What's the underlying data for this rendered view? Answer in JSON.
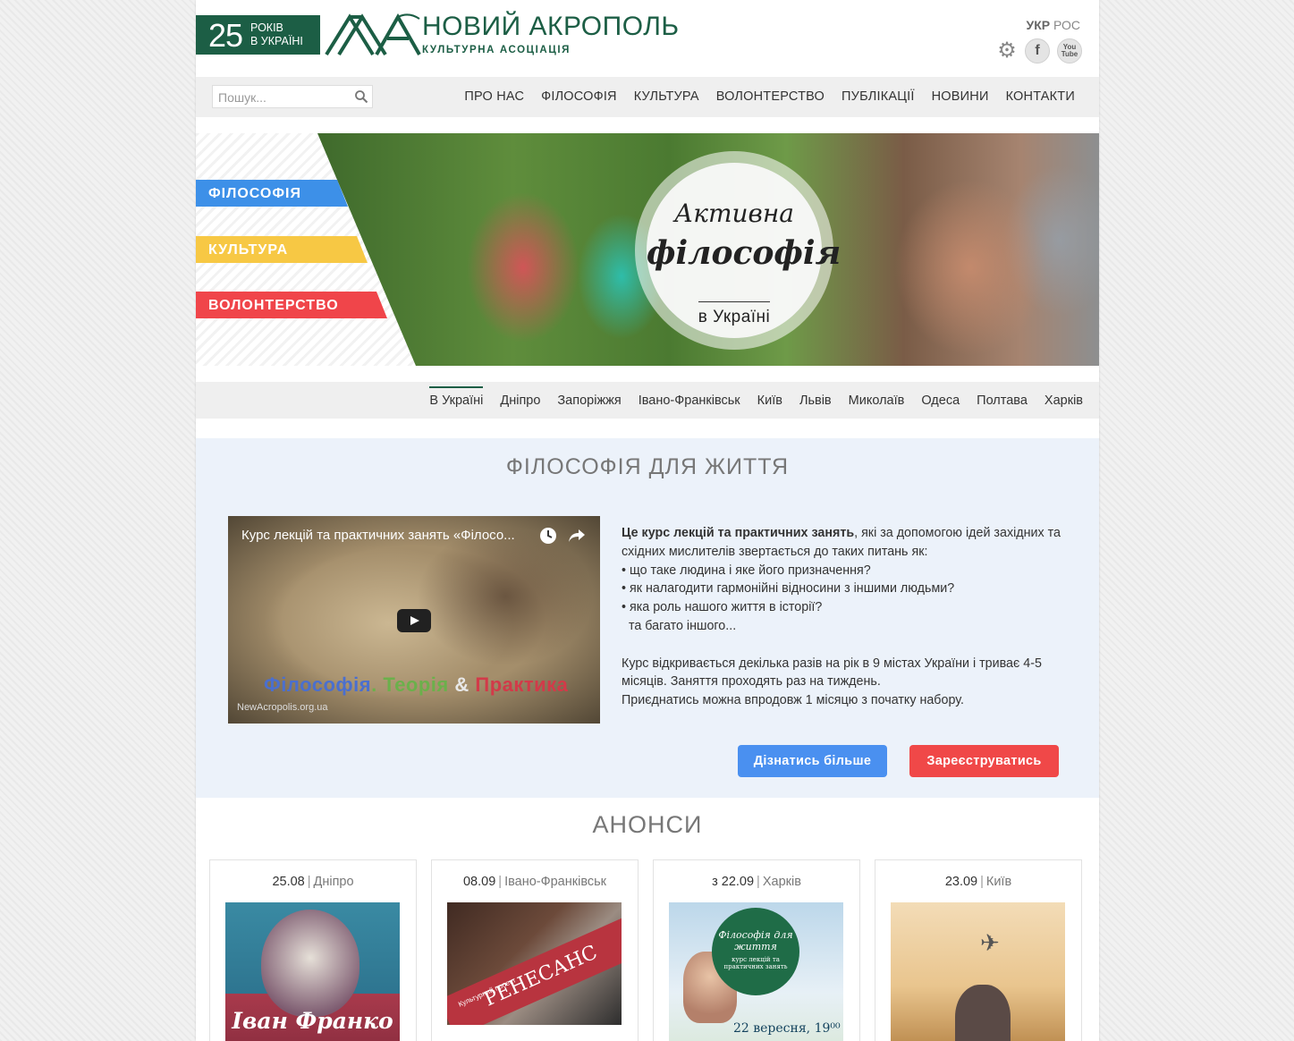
{
  "header": {
    "badge_number": "25",
    "badge_line1": "РОКІВ",
    "badge_line2": "В УКРАЇНІ",
    "logo_title": "НОВИЙ АКРОПОЛЬ",
    "logo_subtitle": "КУЛЬТУРНА АСОЦІАЦІЯ",
    "lang_active": "УКР",
    "lang_other": "РОС",
    "icons": [
      "gear-icon",
      "facebook-icon",
      "youtube-icon"
    ],
    "facebook_glyph": "f",
    "youtube_line1": "You",
    "youtube_line2": "Tube"
  },
  "search": {
    "placeholder": "Пошук..."
  },
  "menu": {
    "items": [
      "ПРО НАС",
      "ФІЛОСОФІЯ",
      "КУЛЬТУРА",
      "ВОЛОНТЕРСТВО",
      "ПУБЛІКАЦІЇ",
      "НОВИНИ",
      "КОНТАКТИ"
    ]
  },
  "banner": {
    "tag1": "ФІЛОСОФІЯ",
    "tag2": "КУЛЬТУРА",
    "tag3": "ВОЛОНТЕРСТВО",
    "seal_line1": "Активна",
    "seal_line2": "філософія",
    "seal_line3": "в Україні",
    "colors": {
      "philosophy": "#3d90e8",
      "culture": "#f7c844",
      "volunteer": "#f0454a"
    }
  },
  "cities": {
    "items": [
      "В Україні",
      "Дніпро",
      "Запоріжжя",
      "Івано-Франківськ",
      "Київ",
      "Львів",
      "Миколаїв",
      "Одеса",
      "Полтава",
      "Харків"
    ],
    "active": "В Україні"
  },
  "philosophy": {
    "title": "ФІЛОСОФІЯ ДЛЯ ЖИТТЯ",
    "video_title": "Курс лекцій та практичних занять «Філосо...",
    "video_caption_a": "Філософія",
    "video_caption_b": ".",
    "video_caption_c": " Теорія ",
    "video_caption_d": "&",
    "video_caption_e": " Практика",
    "video_url": "NewAcropolis.org.ua",
    "intro_bold": "Це курс лекцій та практичних занять",
    "intro_rest": ", які за допомогою ідей західних та східних мислителів звертається до таких питань як:",
    "bullet1": "• що таке людина і яке його призначення?",
    "bullet2": "• як налагодити гармонійні відносини з іншими людьми?",
    "bullet3": "• яка роль нашого життя в історії?",
    "more_line": "  та багато іншого...",
    "para2": "Курс відкривається декілька разів на рік в 9 містах України і триває 4-5 місяців. Заняття проходять раз на тиждень.",
    "para3": "Приєднатись можна впродовж 1 місяцю з початку набору.",
    "btn_more": "Дізнатись більше",
    "btn_register": "Зареєструватись"
  },
  "announcements": {
    "title": "АНОНСИ",
    "cards": [
      {
        "date": "25.08",
        "city": "Дніпро",
        "image_text": "Іван Франко"
      },
      {
        "date": "08.09",
        "city": "Івано-Франківськ",
        "image_text": "РЕНЕСАНС",
        "image_sub": "Культурний проект"
      },
      {
        "date": "з 22.09",
        "city": "Харків",
        "image_text": "Філософія для життя",
        "image_sub": "курс лекцій та практичних занять",
        "image_date": "22 вересня, 19⁰⁰"
      },
      {
        "date": "23.09",
        "city": "Київ"
      }
    ]
  }
}
